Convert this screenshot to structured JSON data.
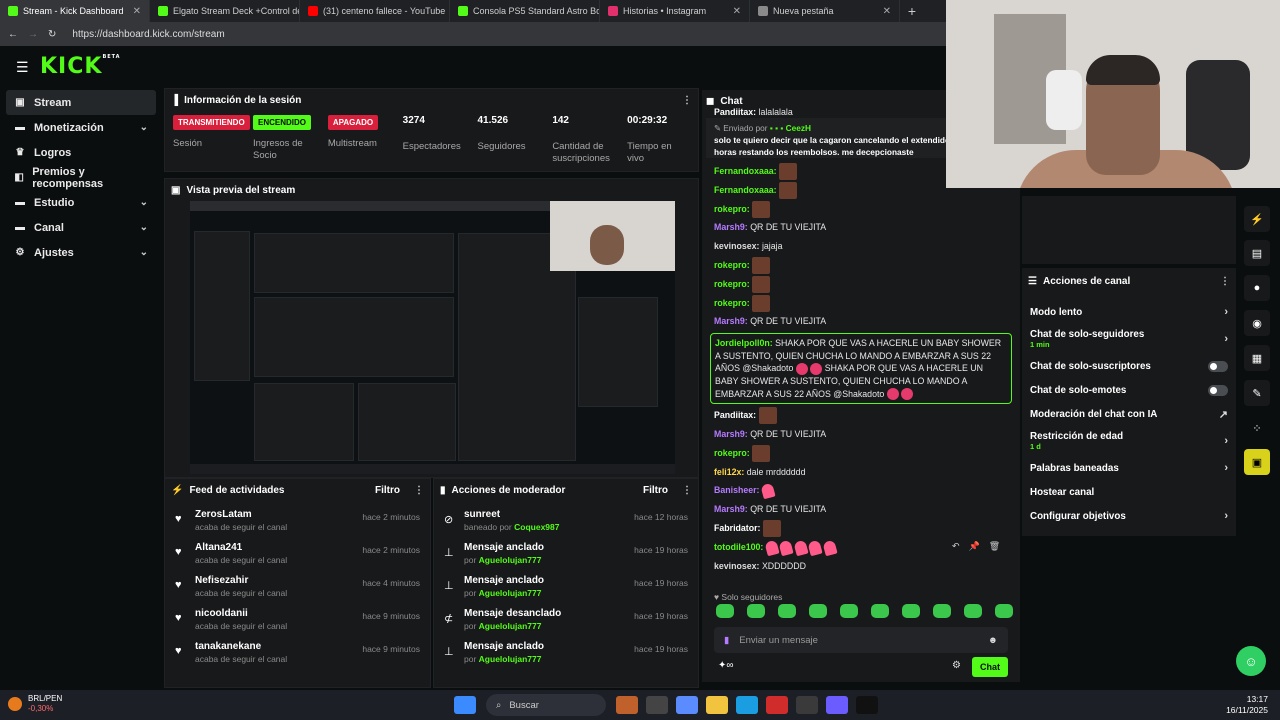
{
  "tabs": [
    {
      "label": "Stream - Kick Dashboard",
      "color": "#53fc18"
    },
    {
      "label": "Elgato Stream Deck +Control de",
      "color": "#53fc18"
    },
    {
      "label": "(31) centeno fallece - YouTube",
      "color": "#ff0000"
    },
    {
      "label": "Consola PS5 Standard Astro Bot",
      "color": "#53fc18"
    },
    {
      "label": "Historias • Instagram",
      "color": "#e1306c"
    },
    {
      "label": "Nueva pestaña",
      "color": "#8a8a8a"
    }
  ],
  "url": "https://dashboard.kick.com/stream",
  "logo": "KICK",
  "logo_sup": "BETA",
  "sidebar": [
    {
      "label": "Stream",
      "icon": "stream-icon",
      "chevron": ""
    },
    {
      "label": "Monetización",
      "icon": "monetization-icon",
      "chevron": "⌄"
    },
    {
      "label": "Logros",
      "icon": "trophy-icon",
      "chevron": ""
    },
    {
      "label": "Premios y recompensas",
      "icon": "gift-icon",
      "chevron": ""
    },
    {
      "label": "Estudio",
      "icon": "studio-icon",
      "chevron": "⌄"
    },
    {
      "label": "Canal",
      "icon": "channel-icon",
      "chevron": "⌄"
    },
    {
      "label": "Ajustes",
      "icon": "gear-icon",
      "chevron": "⌄"
    }
  ],
  "session": {
    "title": "Información de la sesión",
    "stats": [
      {
        "badge": "TRANSMITIENDO",
        "kind": "red",
        "label": "Sesión"
      },
      {
        "badge": "ENCENDIDO",
        "kind": "green",
        "label": "Ingresos de Socio"
      },
      {
        "badge": "APAGADO",
        "kind": "red",
        "label": "Multistream"
      },
      {
        "value": "3274",
        "label": "Espectadores"
      },
      {
        "value": "41.526",
        "label": "Seguidores"
      },
      {
        "value": "142",
        "label": "Cantidad de suscripciones"
      },
      {
        "value": "00:29:32",
        "label": "Tiempo en vivo"
      }
    ]
  },
  "preview": {
    "title": "Vista previa del stream"
  },
  "feed": {
    "title": "Feed de actividades",
    "filter": "Filtro",
    "items": [
      {
        "name": "ZerosLatam",
        "sub": "acaba de seguir el canal",
        "time": "hace 2 minutos"
      },
      {
        "name": "Altana241",
        "sub": "acaba de seguir el canal",
        "time": "hace 2 minutos"
      },
      {
        "name": "Nefisezahir",
        "sub": "acaba de seguir el canal",
        "time": "hace 4 minutos"
      },
      {
        "name": "nicooldanii",
        "sub": "acaba de seguir el canal",
        "time": "hace 9 minutos"
      },
      {
        "name": "tanakanekane",
        "sub": "acaba de seguir el canal",
        "time": "hace 9 minutos"
      }
    ]
  },
  "moderator": {
    "title": "Acciones de moderador",
    "filter": "Filtro",
    "items": [
      {
        "action": "sunreet",
        "prefix": "baneado por",
        "by": "Coquex987",
        "time": "hace 12 horas",
        "icon": "ban-icon"
      },
      {
        "action": "Mensaje anclado",
        "prefix": "por",
        "by": "Aguelolujan777",
        "time": "hace 19 horas",
        "icon": "pin-icon"
      },
      {
        "action": "Mensaje anclado",
        "prefix": "por",
        "by": "Aguelolujan777",
        "time": "hace 19 horas",
        "icon": "pin-icon"
      },
      {
        "action": "Mensaje desanclado",
        "prefix": "por",
        "by": "Aguelolujan777",
        "time": "hace 19 horas",
        "icon": "unpin-icon"
      },
      {
        "action": "Mensaje anclado",
        "prefix": "por",
        "by": "Aguelolujan777",
        "time": "hace 19 horas",
        "icon": "pin-icon"
      }
    ]
  },
  "chat": {
    "title": "Chat",
    "pinned_by": "Enviado por",
    "pinned_user": "CeezH",
    "pinned_text": "solo te quiero decir que la cagaron cancelando el extendido de mas de 40 horas restando los reembolsos. me decepcionaste",
    "messages": [
      {
        "user": "Pandiitax:",
        "color": "#ffffff",
        "text": "lalalalala",
        "emotes": 0
      },
      {
        "user": "Fernandoxaaa:",
        "color": "#53fc18",
        "text": "",
        "emotes": 1
      },
      {
        "user": "Fernandoxaaa:",
        "color": "#53fc18",
        "text": "",
        "emotes": 1
      },
      {
        "user": "rokepro:",
        "color": "#53fc18",
        "text": "",
        "emotes": 1
      },
      {
        "user": "Marsh9:",
        "color": "#b67bff",
        "text": "QR DE TU VIEJITA",
        "emotes": 0
      },
      {
        "user": "kevinosex:",
        "color": "#dddddd",
        "text": "jajaja",
        "emotes": 0
      },
      {
        "user": "rokepro:",
        "color": "#53fc18",
        "text": "",
        "emotes": 1
      },
      {
        "user": "rokepro:",
        "color": "#53fc18",
        "text": "",
        "emotes": 1
      },
      {
        "user": "rokepro:",
        "color": "#53fc18",
        "text": "",
        "emotes": 1
      },
      {
        "user": "Marsh9:",
        "color": "#b67bff",
        "text": "QR DE TU VIEJITA",
        "emotes": 0
      }
    ],
    "highlight_user": "Jordielpoll0n:",
    "highlight_a": "SHAKA POR QUE VAS A HACERLE UN BABY SHOWER A SUSTENTO, QUIEN CHUCHA LO MANDO A EMBARZAR A SUS 22 AÑOS @Shakadoto",
    "highlight_b": "SHAKA POR QUE VAS A HACERLE UN BABY SHOWER A SUSTENTO, QUIEN CHUCHA LO MANDO A EMBARZAR A SUS 22 AÑOS @Shakadoto",
    "messages2": [
      {
        "user": "Pandiitax:",
        "color": "#ffffff",
        "text": "",
        "emotes": 1,
        "kind": "brown"
      },
      {
        "user": "Marsh9:",
        "color": "#b67bff",
        "text": "QR DE TU VIEJITA",
        "emotes": 0,
        "kind": "brown"
      },
      {
        "user": "rokepro:",
        "color": "#53fc18",
        "text": "",
        "emotes": 1,
        "kind": "brown"
      },
      {
        "user": "feli12x:",
        "color": "#ffd84a",
        "text": "dale mrdddddd",
        "emotes": 0,
        "kind": "brown"
      },
      {
        "user": "Banisheer:",
        "color": "#b67bff",
        "text": "",
        "emotes": 1,
        "kind": "pink"
      },
      {
        "user": "Marsh9:",
        "color": "#b67bff",
        "text": "QR DE TU VIEJITA",
        "emotes": 0,
        "kind": "brown"
      },
      {
        "user": "Fabridator:",
        "color": "#ffffff",
        "text": "",
        "emotes": 1,
        "kind": "brown"
      },
      {
        "user": "totodile100:",
        "color": "#53fc18",
        "text": "",
        "emotes": 5,
        "kind": "pink"
      },
      {
        "user": "kevinosex:",
        "color": "#dddddd",
        "text": "XDDDDDD",
        "emotes": 0,
        "kind": "brown"
      }
    ],
    "followers_only": "Solo seguidores",
    "placeholder": "Enviar un mensaje",
    "send": "Chat"
  },
  "actions": {
    "title": "Acciones de canal",
    "items": [
      {
        "label": "Modo lento",
        "sub": "",
        "ctrl": "chevron"
      },
      {
        "label": "Chat de solo-seguidores",
        "sub": "1 min",
        "ctrl": "chevron"
      },
      {
        "label": "Chat de solo-suscriptores",
        "sub": "",
        "ctrl": "toggle"
      },
      {
        "label": "Chat de solo-emotes",
        "sub": "",
        "ctrl": "toggle"
      },
      {
        "label": "Moderación del chat con IA",
        "sub": "",
        "ctrl": "external"
      },
      {
        "label": "Restricción de edad",
        "sub": "1 d",
        "ctrl": "chevron"
      },
      {
        "label": "Palabras baneadas",
        "sub": "",
        "ctrl": "chevron"
      },
      {
        "label": "Hostear canal",
        "sub": "",
        "ctrl": ""
      },
      {
        "label": "Configurar objetivos",
        "sub": "",
        "ctrl": "chevron"
      }
    ]
  },
  "taskbar": {
    "market_pair": "BRL/PEN",
    "market_change": "-0,30%",
    "search": "Buscar",
    "time": "13:17",
    "date": "16/11/2025"
  }
}
